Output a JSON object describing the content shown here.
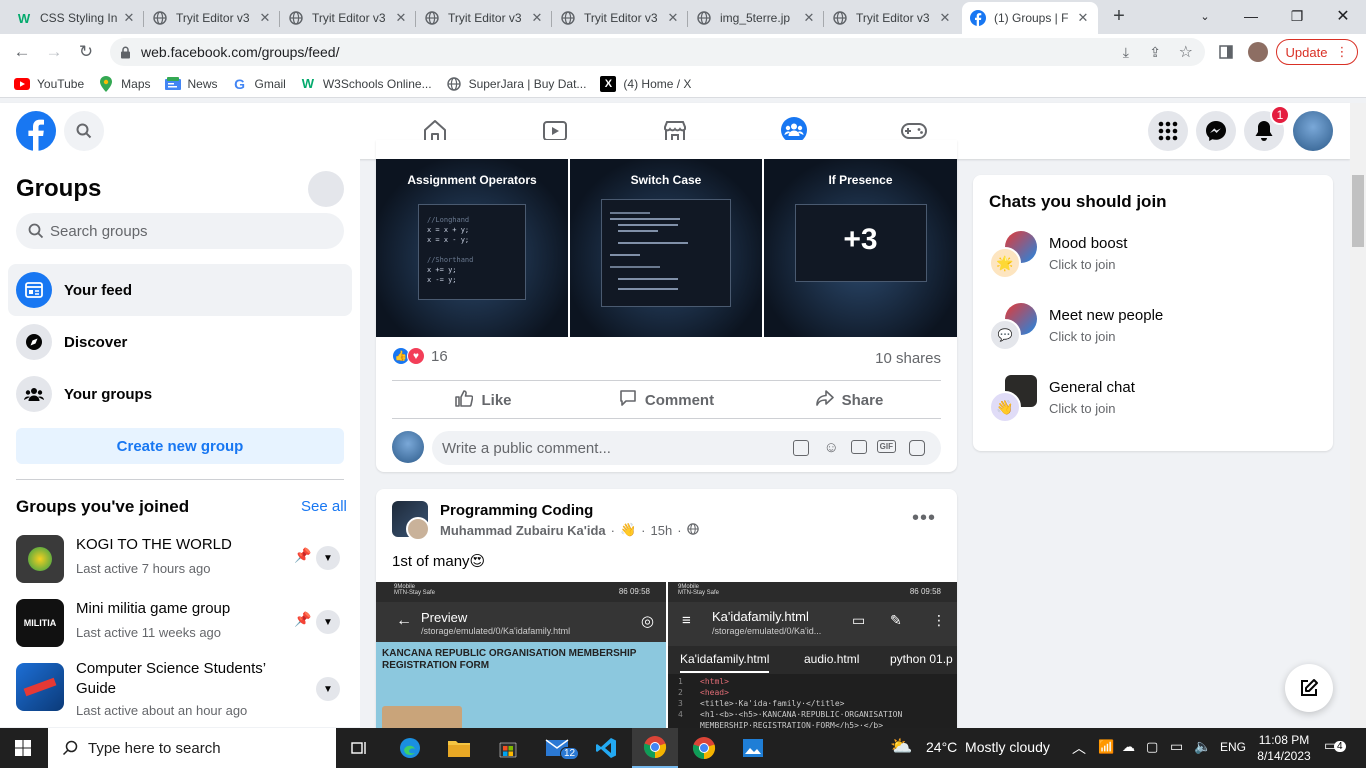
{
  "browser": {
    "tabs": [
      {
        "title": "CSS Styling In",
        "icon": "w3schools-icon"
      },
      {
        "title": "Tryit Editor v3",
        "icon": "globe-icon"
      },
      {
        "title": "Tryit Editor v3",
        "icon": "globe-icon"
      },
      {
        "title": "Tryit Editor v3",
        "icon": "globe-icon"
      },
      {
        "title": "Tryit Editor v3",
        "icon": "globe-icon"
      },
      {
        "title": "img_5terre.jp",
        "icon": "globe-icon"
      },
      {
        "title": "Tryit Editor v3",
        "icon": "globe-icon"
      },
      {
        "title": "(1) Groups | F",
        "icon": "facebook-icon"
      }
    ],
    "url": "web.facebook.com/groups/feed/",
    "update_label": "Update",
    "bookmarks": [
      {
        "label": "YouTube",
        "icon": "youtube-icon"
      },
      {
        "label": "Maps",
        "icon": "maps-icon"
      },
      {
        "label": "News",
        "icon": "news-icon"
      },
      {
        "label": "Gmail",
        "icon": "google-icon"
      },
      {
        "label": "W3Schools Online...",
        "icon": "w3schools-icon"
      },
      {
        "label": "SuperJara | Buy Dat...",
        "icon": "globe-icon"
      },
      {
        "label": "(4) Home / X",
        "icon": "x-icon"
      }
    ]
  },
  "fb": {
    "notification_count": "1",
    "brand_color": "#1877f2"
  },
  "sidebar": {
    "title": "Groups",
    "search_placeholder": "Search groups",
    "items": [
      {
        "label": "Your feed"
      },
      {
        "label": "Discover"
      },
      {
        "label": "Your groups"
      }
    ],
    "create_label": "Create new group",
    "joined_title": "Groups you've joined",
    "see_all": "See all",
    "groups": [
      {
        "name": "KOGI TO THE WORLD",
        "last_active": "Last active 7 hours ago"
      },
      {
        "name": "Mini militia game group",
        "last_active": "Last active 11 weeks ago"
      },
      {
        "name": "Computer Science Students’ Guide",
        "last_active": "Last active about an hour ago"
      }
    ]
  },
  "post1": {
    "slides": [
      {
        "title": "Assignment Operators",
        "code1": "//Longhand",
        "code2": "x = x + y;",
        "code3": "x = x - y;",
        "code4": "//Shorthand",
        "code5": "x += y;",
        "code6": "x -= y;"
      },
      {
        "title": "Switch Case"
      },
      {
        "title": "If Presence",
        "more": "+3"
      }
    ],
    "reactions_count": "16",
    "shares": "10 shares",
    "actions": {
      "like": "Like",
      "comment": "Comment",
      "share": "Share"
    },
    "comment_placeholder": "Write a public comment..."
  },
  "post2": {
    "group": "Programming Coding",
    "author": "Muhammad Zubairu Ka'ida",
    "time": "15h",
    "text": "1st of many😍",
    "left_shot": {
      "carrier": "9Mobile",
      "carrier2": "MTN-Stay Safe",
      "status": "86 09:58",
      "header": "Preview",
      "path": "/storage/emulated/0/Ka'idafamily.html",
      "heading": "KANCANA REPUBLIC ORGANISATION MEMBERSHIP REGISTRATION FORM"
    },
    "right_shot": {
      "carrier": "9Mobile",
      "carrier2": "MTN-Stay Safe",
      "status": "86 09:58",
      "file": "Ka'idafamily.html",
      "path": "/storage/emulated/0/Ka'id...",
      "tabs": [
        "Ka'idafamily.html",
        "audio.html",
        "python 01.p"
      ],
      "lines": [
        "<html>",
        "<head>",
        "<title>·Ka'ida·family·</title>",
        "<h1·<b>·<h5>·KANCANA·REPUBLIC·ORGANISATION",
        "MEMBERSHIP·REGISTRATION·FORM</h5>·</b>"
      ],
      "line_numbers": [
        "1",
        "2",
        "3",
        "4",
        ""
      ]
    }
  },
  "chats": {
    "title": "Chats you should join",
    "items": [
      {
        "name": "Mood boost",
        "sub": "Click to join"
      },
      {
        "name": "Meet new people",
        "sub": "Click to join"
      },
      {
        "name": "General chat",
        "sub": "Click to join"
      }
    ]
  },
  "taskbar": {
    "search_placeholder": "Type here to search",
    "weather": "24°C  Mostly cloudy",
    "language": "ENG",
    "time": "11:08 PM",
    "date": "8/14/2023",
    "mail_badge": "12",
    "notif_badge": "4"
  }
}
